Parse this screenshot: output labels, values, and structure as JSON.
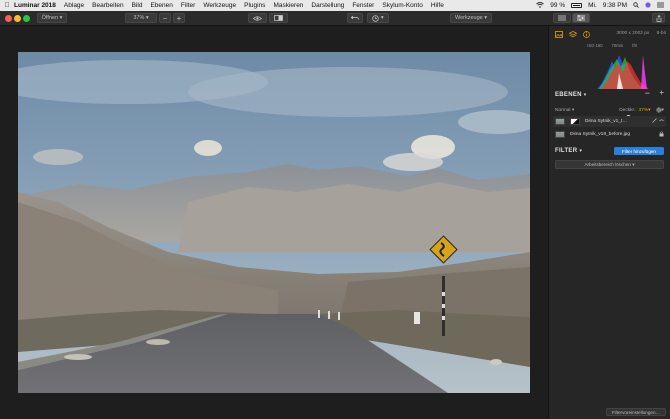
{
  "menubar": {
    "app_name": "Luminar 2018",
    "items": [
      "Ablage",
      "Bearbeiten",
      "Bild",
      "Ebenen",
      "Filter",
      "Werkzeuge",
      "Plugins",
      "Maskieren",
      "Darstellung",
      "Fenster",
      "Skylum-Konto",
      "Hilfe"
    ],
    "battery": "99 %",
    "weekday": "Mi.",
    "time": "9:38 PM"
  },
  "toolbar": {
    "open_label": "Öffnen",
    "zoom_value": "37%",
    "tools_label": "Werkzeuge"
  },
  "panel": {
    "image_size": "3000 x 2002 px",
    "bit_depth": "8-bit",
    "exif": {
      "iso": "ISO 160",
      "focal": "70mm",
      "aperture": "f/8"
    },
    "layers_title": "EBENEN",
    "blend_mode": "Normal",
    "opacity_label": "Deckkr.:",
    "opacity_value": "37%",
    "opacity_fraction": 0.37,
    "layers": [
      {
        "name": "Dima Sytnik_v1_t…"
      },
      {
        "name": "Dima Sytnik_v18_before.jpg"
      }
    ],
    "filter_title": "FILTER",
    "add_filter_label": "Filter hinzufügen",
    "clear_workspace_label": "Arbeitsbereich löschen",
    "presets_label": "Filtervoreinstellungen…"
  },
  "colors": {
    "accent_blue": "#2b7fd9",
    "accent_orange": "#e0a800",
    "panel_bg": "#262626"
  }
}
